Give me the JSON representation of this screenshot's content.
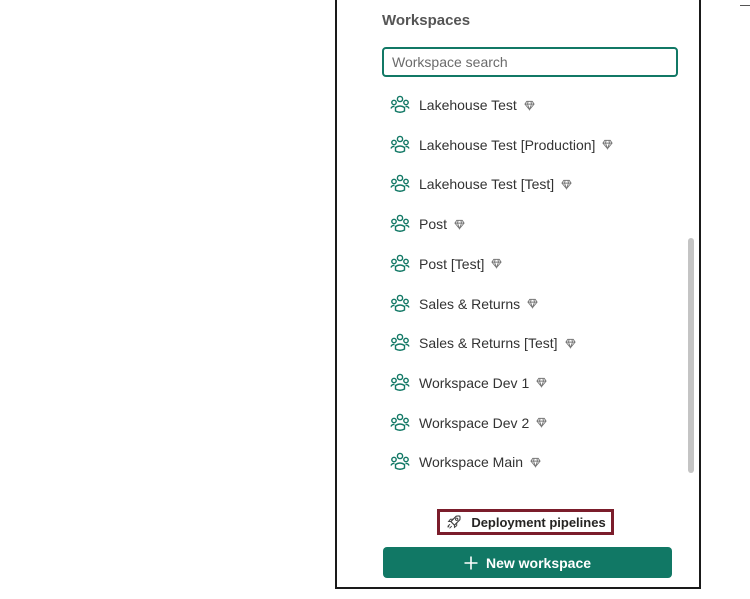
{
  "panel": {
    "title": "Workspaces",
    "search_placeholder": "Workspace search"
  },
  "workspaces": [
    {
      "name": "Lakehouse Test",
      "icon": "workspace-icon",
      "premium_icon": "diamond-icon"
    },
    {
      "name": "Lakehouse Test [Production]",
      "icon": "workspace-icon",
      "premium_icon": "diamond-icon"
    },
    {
      "name": "Lakehouse Test [Test]",
      "icon": "workspace-icon",
      "premium_icon": "diamond-icon"
    },
    {
      "name": "Post",
      "icon": "workspace-icon",
      "premium_icon": "diamond-icon"
    },
    {
      "name": "Post [Test]",
      "icon": "workspace-icon",
      "premium_icon": "diamond-icon"
    },
    {
      "name": "Sales & Returns",
      "icon": "workspace-icon",
      "premium_icon": "diamond-icon"
    },
    {
      "name": "Sales & Returns [Test]",
      "icon": "workspace-icon",
      "premium_icon": "diamond-icon"
    },
    {
      "name": "Workspace Dev 1",
      "icon": "workspace-icon",
      "premium_icon": "diamond-icon"
    },
    {
      "name": "Workspace Dev 2",
      "icon": "workspace-icon",
      "premium_icon": "diamond-icon"
    },
    {
      "name": "Workspace Main",
      "icon": "workspace-icon",
      "premium_icon": "diamond-icon"
    }
  ],
  "footer": {
    "deployment_label": "Deployment pipelines",
    "deployment_icon": "rocket-icon",
    "new_workspace_label": "New workspace",
    "new_workspace_icon": "plus-icon"
  },
  "colors": {
    "accent": "#117865",
    "highlight_border": "#7b1d2b"
  }
}
